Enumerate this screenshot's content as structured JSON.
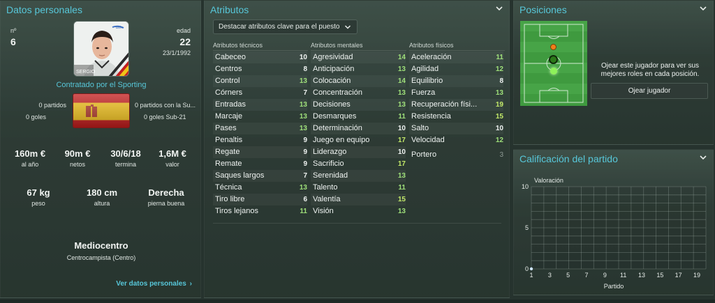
{
  "personal": {
    "title": "Datos personales",
    "number_label": "nº",
    "number": "6",
    "age_label": "edad",
    "age": "22",
    "birthdate": "23/1/1992",
    "photo_caption": "SERGIO",
    "contract": "Contratado por el Sporting",
    "left_stats": [
      "0 partidos",
      "0 goles"
    ],
    "right_stats": [
      "0 partidos con la Su...",
      "0 goles Sub-21"
    ],
    "money": [
      {
        "value": "160m €",
        "label": "al año"
      },
      {
        "value": "90m €",
        "label": "netos"
      },
      {
        "value": "30/6/18",
        "label": "termina"
      },
      {
        "value": "1,6M €",
        "label": "valor"
      }
    ],
    "physical": [
      {
        "value": "67 kg",
        "label": "peso"
      },
      {
        "value": "180 cm",
        "label": "altura"
      },
      {
        "value": "Derecha",
        "label": "pierna buena"
      }
    ],
    "role": "Mediocentro",
    "role_detail": "Centrocampista (Centro)",
    "link": "Ver datos personales"
  },
  "attributes": {
    "title": "Atributos",
    "dropdown": "Destacar atributos clave para el puesto",
    "columns": [
      {
        "header": "Atributos técnicos",
        "rows": [
          {
            "name": "Cabeceo",
            "value": "10",
            "tone": "white"
          },
          {
            "name": "Centros",
            "value": "8",
            "tone": "white"
          },
          {
            "name": "Control",
            "value": "13",
            "tone": "green"
          },
          {
            "name": "Córners",
            "value": "7",
            "tone": "white"
          },
          {
            "name": "Entradas",
            "value": "13",
            "tone": "green"
          },
          {
            "name": "Marcaje",
            "value": "13",
            "tone": "green"
          },
          {
            "name": "Pases",
            "value": "13",
            "tone": "green"
          },
          {
            "name": "Penaltis",
            "value": "9",
            "tone": "white"
          },
          {
            "name": "Regate",
            "value": "9",
            "tone": "white"
          },
          {
            "name": "Remate",
            "value": "9",
            "tone": "white"
          },
          {
            "name": "Saques largos",
            "value": "7",
            "tone": "white"
          },
          {
            "name": "Técnica",
            "value": "13",
            "tone": "green"
          },
          {
            "name": "Tiro libre",
            "value": "6",
            "tone": "white"
          },
          {
            "name": "Tiros lejanos",
            "value": "11",
            "tone": "green"
          }
        ]
      },
      {
        "header": "Atributos mentales",
        "rows": [
          {
            "name": "Agresividad",
            "value": "14",
            "tone": "green"
          },
          {
            "name": "Anticipación",
            "value": "13",
            "tone": "green"
          },
          {
            "name": "Colocación",
            "value": "14",
            "tone": "green"
          },
          {
            "name": "Concentración",
            "value": "13",
            "tone": "green"
          },
          {
            "name": "Decisiones",
            "value": "13",
            "tone": "green"
          },
          {
            "name": "Desmarques",
            "value": "11",
            "tone": "green"
          },
          {
            "name": "Determinación",
            "value": "10",
            "tone": "white"
          },
          {
            "name": "Juego en equipo",
            "value": "17",
            "tone": "lime"
          },
          {
            "name": "Liderazgo",
            "value": "10",
            "tone": "white"
          },
          {
            "name": "Sacrificio",
            "value": "17",
            "tone": "lime"
          },
          {
            "name": "Serenidad",
            "value": "13",
            "tone": "green"
          },
          {
            "name": "Talento",
            "value": "11",
            "tone": "green"
          },
          {
            "name": "Valentía",
            "value": "15",
            "tone": "lime"
          },
          {
            "name": "Visión",
            "value": "13",
            "tone": "green"
          }
        ]
      },
      {
        "header": "Atributos físicos",
        "rows": [
          {
            "name": "Aceleración",
            "value": "11",
            "tone": "green"
          },
          {
            "name": "Agilidad",
            "value": "12",
            "tone": "green"
          },
          {
            "name": "Equilibrio",
            "value": "8",
            "tone": "white"
          },
          {
            "name": "Fuerza",
            "value": "13",
            "tone": "green"
          },
          {
            "name": "Recuperación físi...",
            "value": "19",
            "tone": "lime"
          },
          {
            "name": "Resistencia",
            "value": "15",
            "tone": "lime"
          },
          {
            "name": "Salto",
            "value": "10",
            "tone": "white"
          },
          {
            "name": "Velocidad",
            "value": "12",
            "tone": "green"
          }
        ],
        "extra": {
          "name": "Portero",
          "value": "3",
          "tone": "grey"
        }
      }
    ]
  },
  "positions": {
    "title": "Posiciones",
    "text": "Ojear este jugador para ver sus mejores roles en cada posición.",
    "button": "Ojear jugador"
  },
  "rating": {
    "title": "Calificación del partido"
  },
  "chart_data": {
    "type": "line",
    "ylabel": "Valoración",
    "xlabel": "Partido",
    "ylim": [
      0,
      10
    ],
    "yticks": [
      "0",
      "5",
      "10"
    ],
    "xticks": [
      "1",
      "3",
      "5",
      "7",
      "9",
      "11",
      "13",
      "15",
      "17",
      "19"
    ],
    "grid": true,
    "series": [
      {
        "x": [
          1
        ],
        "y": [
          0
        ]
      }
    ]
  },
  "colors": {
    "accent": "#57c7d9",
    "attr_green": "#9fe07a",
    "attr_lime": "#c3ea69"
  }
}
